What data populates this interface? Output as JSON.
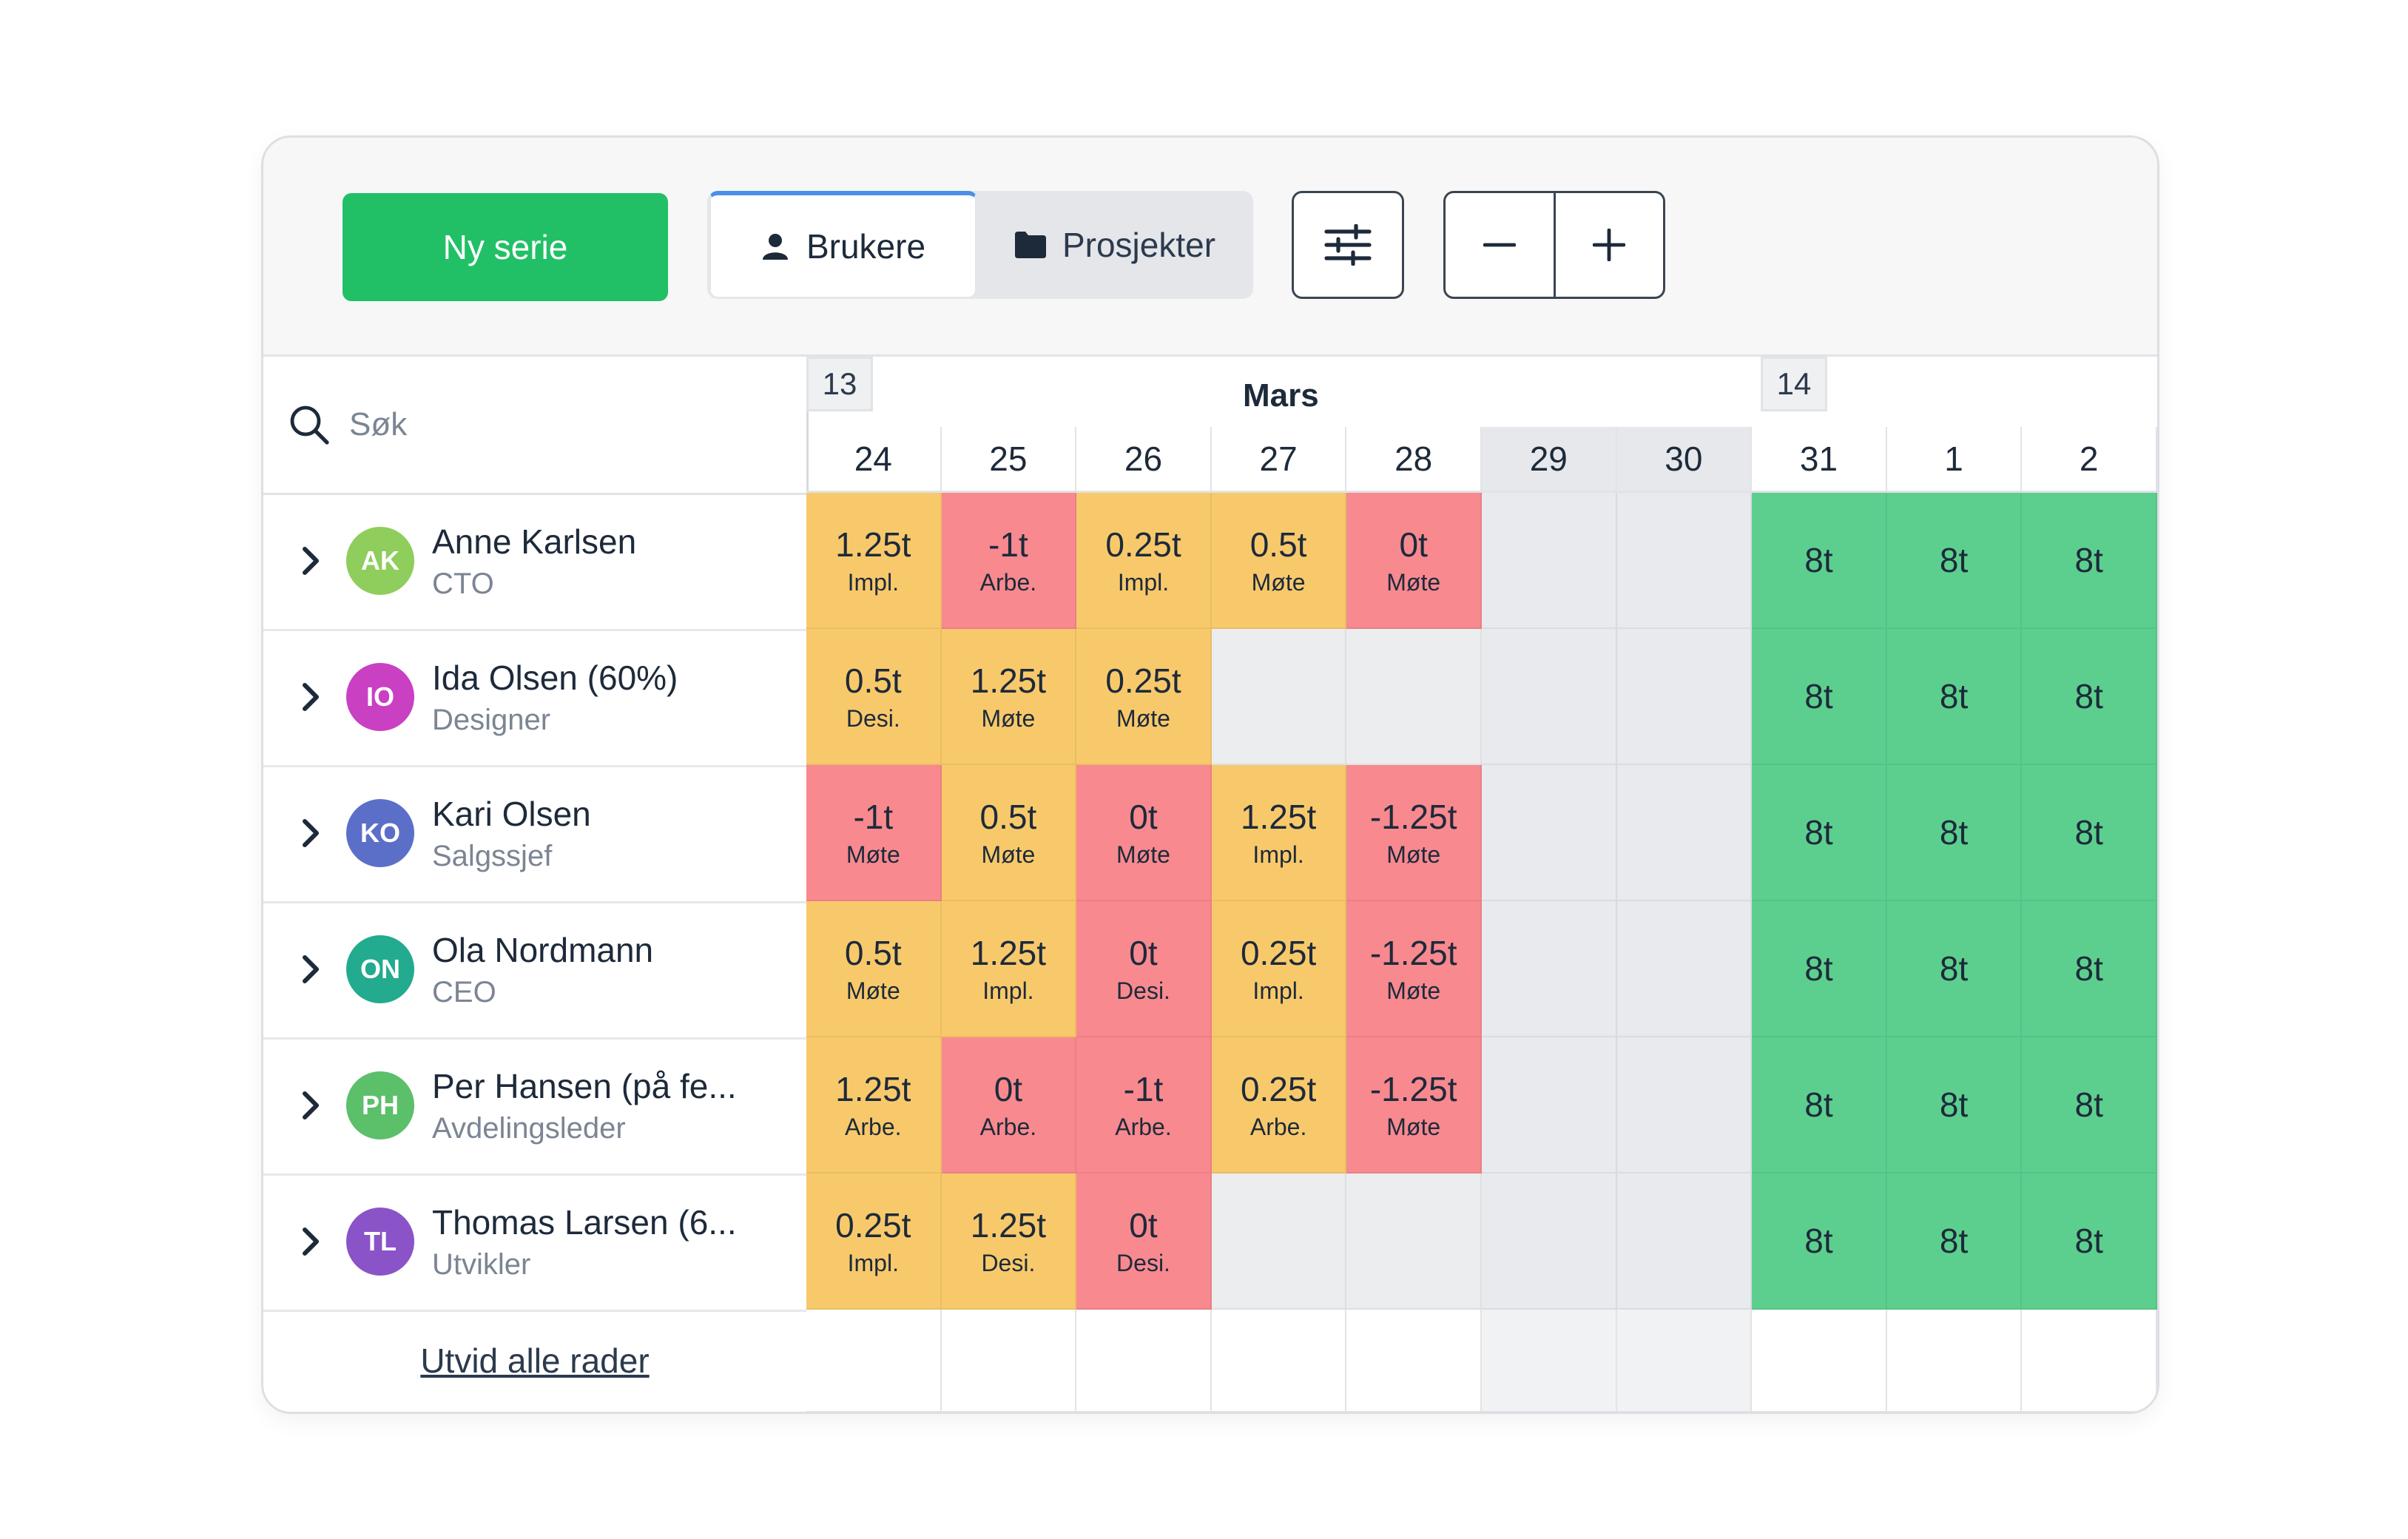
{
  "toolbar": {
    "new_series_label": "Ny serie",
    "tab_users_label": "Brukere",
    "tab_projects_label": "Prosjekter",
    "active_tab": "Brukere"
  },
  "search": {
    "placeholder": "Søk"
  },
  "calendar": {
    "month": "Mars",
    "weeks": [
      "13",
      "14"
    ],
    "days": [
      {
        "label": "24",
        "weekend": false
      },
      {
        "label": "25",
        "weekend": false
      },
      {
        "label": "26",
        "weekend": false
      },
      {
        "label": "27",
        "weekend": false
      },
      {
        "label": "28",
        "weekend": false
      },
      {
        "label": "29",
        "weekend": true
      },
      {
        "label": "30",
        "weekend": true
      },
      {
        "label": "31",
        "weekend": false
      },
      {
        "label": "1",
        "weekend": false
      },
      {
        "label": "2",
        "weekend": false
      }
    ]
  },
  "people": [
    {
      "initials": "AK",
      "name": "Anne Karlsen",
      "role": "CTO",
      "avatar_color": "#8fcd5c",
      "cells": [
        {
          "hours": "1.25t",
          "task": "Impl.",
          "status": "yellow"
        },
        {
          "hours": "-1t",
          "task": "Arbe.",
          "status": "red"
        },
        {
          "hours": "0.25t",
          "task": "Impl.",
          "status": "yellow"
        },
        {
          "hours": "0.5t",
          "task": "Møte",
          "status": "yellow"
        },
        {
          "hours": "0t",
          "task": "Møte",
          "status": "red"
        },
        {
          "hours": "",
          "task": "",
          "status": "weekend"
        },
        {
          "hours": "",
          "task": "",
          "status": "weekend"
        },
        {
          "hours": "8t",
          "task": "",
          "status": "green"
        },
        {
          "hours": "8t",
          "task": "",
          "status": "green"
        },
        {
          "hours": "8t",
          "task": "",
          "status": "green"
        }
      ]
    },
    {
      "initials": "IO",
      "name": "Ida Olsen (60%)",
      "role": "Designer",
      "avatar_color": "#c940c3",
      "cells": [
        {
          "hours": "0.5t",
          "task": "Desi.",
          "status": "yellow"
        },
        {
          "hours": "1.25t",
          "task": "Møte",
          "status": "yellow"
        },
        {
          "hours": "0.25t",
          "task": "Møte",
          "status": "yellow"
        },
        {
          "hours": "",
          "task": "",
          "status": "gray"
        },
        {
          "hours": "",
          "task": "",
          "status": "gray"
        },
        {
          "hours": "",
          "task": "",
          "status": "weekend"
        },
        {
          "hours": "",
          "task": "",
          "status": "weekend"
        },
        {
          "hours": "8t",
          "task": "",
          "status": "green"
        },
        {
          "hours": "8t",
          "task": "",
          "status": "green"
        },
        {
          "hours": "8t",
          "task": "",
          "status": "green"
        }
      ]
    },
    {
      "initials": "KO",
      "name": "Kari Olsen",
      "role": "Salgssjef",
      "avatar_color": "#5b6fc9",
      "cells": [
        {
          "hours": "-1t",
          "task": "Møte",
          "status": "red"
        },
        {
          "hours": "0.5t",
          "task": "Møte",
          "status": "yellow"
        },
        {
          "hours": "0t",
          "task": "Møte",
          "status": "red"
        },
        {
          "hours": "1.25t",
          "task": "Impl.",
          "status": "yellow"
        },
        {
          "hours": "-1.25t",
          "task": "Møte",
          "status": "red"
        },
        {
          "hours": "",
          "task": "",
          "status": "weekend"
        },
        {
          "hours": "",
          "task": "",
          "status": "weekend"
        },
        {
          "hours": "8t",
          "task": "",
          "status": "green"
        },
        {
          "hours": "8t",
          "task": "",
          "status": "green"
        },
        {
          "hours": "8t",
          "task": "",
          "status": "green"
        }
      ]
    },
    {
      "initials": "ON",
      "name": "Ola Nordmann",
      "role": "CEO",
      "avatar_color": "#22ab8e",
      "cells": [
        {
          "hours": "0.5t",
          "task": "Møte",
          "status": "yellow"
        },
        {
          "hours": "1.25t",
          "task": "Impl.",
          "status": "yellow"
        },
        {
          "hours": "0t",
          "task": "Desi.",
          "status": "red"
        },
        {
          "hours": "0.25t",
          "task": "Impl.",
          "status": "yellow"
        },
        {
          "hours": "-1.25t",
          "task": "Møte",
          "status": "red"
        },
        {
          "hours": "",
          "task": "",
          "status": "weekend"
        },
        {
          "hours": "",
          "task": "",
          "status": "weekend"
        },
        {
          "hours": "8t",
          "task": "",
          "status": "green"
        },
        {
          "hours": "8t",
          "task": "",
          "status": "green"
        },
        {
          "hours": "8t",
          "task": "",
          "status": "green"
        }
      ]
    },
    {
      "initials": "PH",
      "name": "Per Hansen (på fe...",
      "role": "Avdelingsleder",
      "avatar_color": "#5cbf6a",
      "cells": [
        {
          "hours": "1.25t",
          "task": "Arbe.",
          "status": "yellow"
        },
        {
          "hours": "0t",
          "task": "Arbe.",
          "status": "red"
        },
        {
          "hours": "-1t",
          "task": "Arbe.",
          "status": "red"
        },
        {
          "hours": "0.25t",
          "task": "Arbe.",
          "status": "yellow"
        },
        {
          "hours": "-1.25t",
          "task": "Møte",
          "status": "red"
        },
        {
          "hours": "",
          "task": "",
          "status": "weekend"
        },
        {
          "hours": "",
          "task": "",
          "status": "weekend"
        },
        {
          "hours": "8t",
          "task": "",
          "status": "green"
        },
        {
          "hours": "8t",
          "task": "",
          "status": "green"
        },
        {
          "hours": "8t",
          "task": "",
          "status": "green"
        }
      ]
    },
    {
      "initials": "TL",
      "name": "Thomas Larsen (6...",
      "role": "Utvikler",
      "avatar_color": "#8a54c8",
      "cells": [
        {
          "hours": "0.25t",
          "task": "Impl.",
          "status": "yellow"
        },
        {
          "hours": "1.25t",
          "task": "Desi.",
          "status": "yellow"
        },
        {
          "hours": "0t",
          "task": "Desi.",
          "status": "red"
        },
        {
          "hours": "",
          "task": "",
          "status": "gray"
        },
        {
          "hours": "",
          "task": "",
          "status": "gray"
        },
        {
          "hours": "",
          "task": "",
          "status": "weekend"
        },
        {
          "hours": "",
          "task": "",
          "status": "weekend"
        },
        {
          "hours": "8t",
          "task": "",
          "status": "green"
        },
        {
          "hours": "8t",
          "task": "",
          "status": "green"
        },
        {
          "hours": "8t",
          "task": "",
          "status": "green"
        }
      ]
    }
  ],
  "footer": {
    "expand_all_label": "Utvid alle rader"
  },
  "colors": {
    "accent_green": "#22c066",
    "status_yellow": "#f8c96b",
    "status_red": "#f7898f",
    "status_green": "#5ccf8e"
  }
}
